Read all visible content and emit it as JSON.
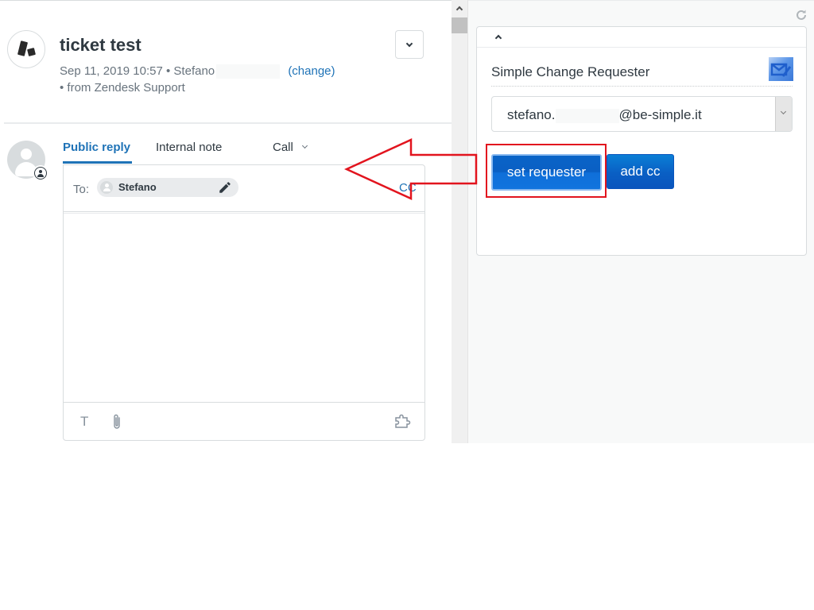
{
  "ticket": {
    "title": "ticket test",
    "meta_line1": "Sep 11, 2019 10:57 • Stefano",
    "change_link": "(change)",
    "meta_line2": "• from Zendesk Support"
  },
  "composer": {
    "tabs": [
      {
        "label": "Public reply",
        "active": true
      },
      {
        "label": "Internal note",
        "active": false
      },
      {
        "label": "Call",
        "active": false
      }
    ],
    "to_label": "To:",
    "recipient": "Stefano",
    "cc_label": "CC",
    "body_text": "",
    "footer_format_glyph": "T"
  },
  "app": {
    "title": "Simple Change Requester",
    "email_select_prefix": "stefano.",
    "email_select_suffix": "@be-simple.it",
    "set_requester_label": "set requester",
    "add_cc_label": "add cc"
  },
  "annotation": {
    "color": "#e2141e",
    "target": "set requester button",
    "points_to": "reply composer"
  },
  "colors": {
    "link": "#1f73b7",
    "button": "#0a5fc4"
  }
}
